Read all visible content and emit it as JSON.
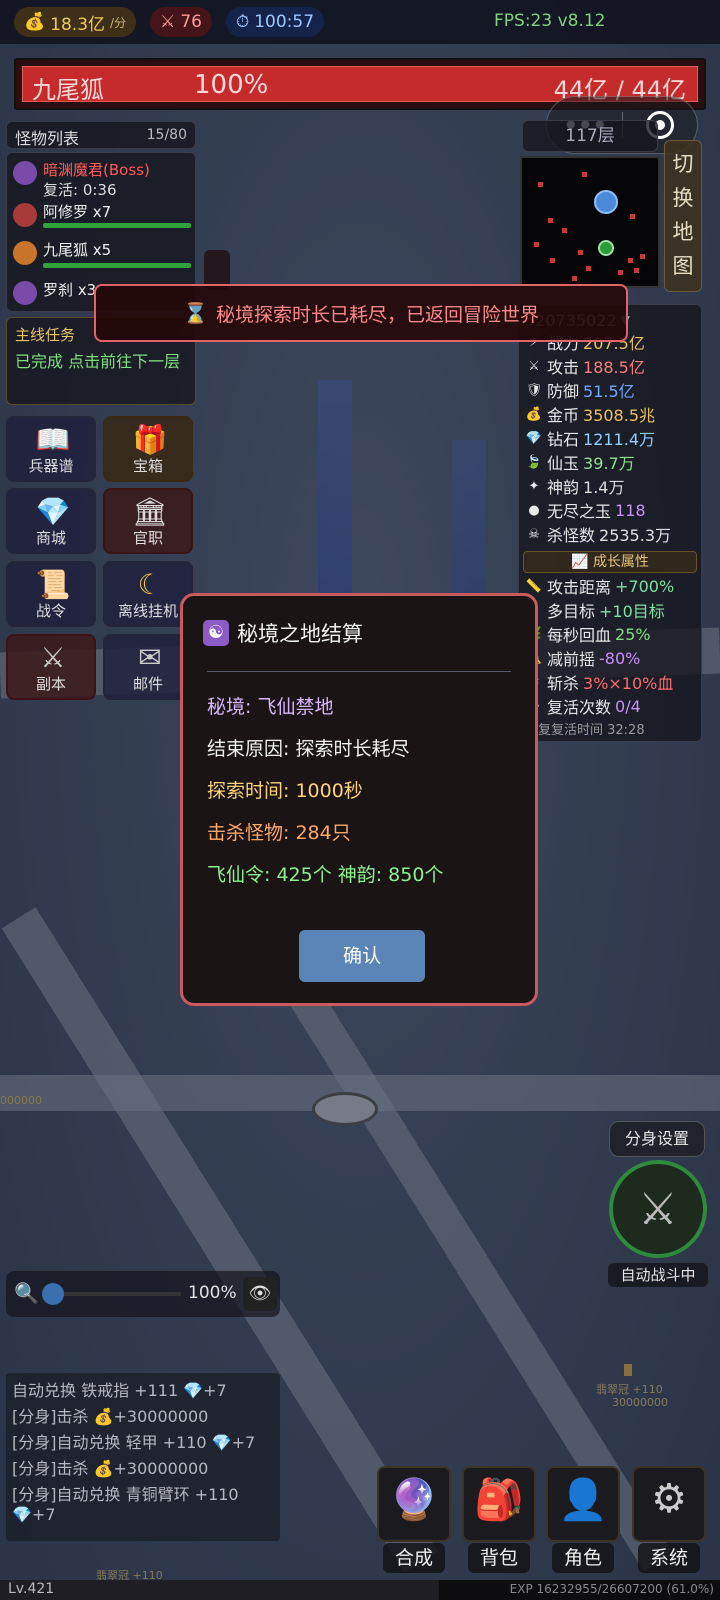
{
  "topbar": {
    "gold_rate": "18.3亿",
    "gold_unit": "/分",
    "power_value": "76",
    "timer": "100:57",
    "fps": "FPS:23 v8.12"
  },
  "boss_bar": {
    "name": "九尾狐",
    "percent_text": "100%",
    "hp_text": "44亿 / 44亿",
    "hp_fraction": 1.0
  },
  "monster_list": {
    "title": "怪物列表",
    "count": "15/80",
    "items": [
      {
        "label": "暗渊魔君(Boss)",
        "sub": "复活: 0:36",
        "icon": "demon-icon"
      },
      {
        "label": "阿修罗 x7",
        "icon": "oni-icon"
      },
      {
        "label": "九尾狐 x5",
        "icon": "fox-icon"
      },
      {
        "label": "罗刹 x3",
        "icon": "demon-icon"
      }
    ]
  },
  "quest": {
    "title": "主线任务",
    "desc": "已完成 点击前往下一层"
  },
  "menu": [
    {
      "label": "兵器谱",
      "icon": "book-icon"
    },
    {
      "label": "宝箱",
      "icon": "gift-icon"
    },
    {
      "label": "商城",
      "icon": "diamond-icon"
    },
    {
      "label": "官职",
      "icon": "temple-icon"
    },
    {
      "label": "战令",
      "icon": "scroll-icon"
    },
    {
      "label": "离线挂机",
      "icon": "moon-icon"
    },
    {
      "label": "副本",
      "icon": "crossed-swords-icon"
    },
    {
      "label": "邮件",
      "icon": "mail-icon"
    }
  ],
  "right": {
    "floor": "117层",
    "switch_map": [
      "切",
      "换",
      "地",
      "图"
    ],
    "player_id": "520735022",
    "stats": [
      {
        "label": "战力",
        "value": "207.5亿",
        "color": "#f0c060",
        "icon": "power-icon"
      },
      {
        "label": "攻击",
        "value": "188.5亿",
        "color": "#ff7a7a",
        "icon": "sword-icon"
      },
      {
        "label": "防御",
        "value": "51.5亿",
        "color": "#6fa8ff",
        "icon": "shield-icon"
      },
      {
        "label": "金币",
        "value": "3508.5兆",
        "color": "#f0c060",
        "icon": "coin-bag-icon"
      },
      {
        "label": "钻石",
        "value": "1211.4万",
        "color": "#8fd0ff",
        "icon": "gem-icon"
      },
      {
        "label": "仙玉",
        "value": "39.7万",
        "color": "#8fe08f",
        "icon": "jade-icon"
      },
      {
        "label": "神韵",
        "value": "1.4万",
        "color": "#dddddd",
        "icon": "spirit-icon"
      },
      {
        "label": "无尽之玉",
        "value": "118",
        "color": "#c98fff",
        "icon": "orb-icon"
      },
      {
        "label": "杀怪数",
        "value": "2535.3万",
        "color": "#e0e0e0",
        "icon": "skull-icon"
      }
    ],
    "growth_title": "成长属性",
    "growth": [
      {
        "label": "攻击距离",
        "value": "+700%",
        "color": "#7fe0a0",
        "icon": "ruler-icon"
      },
      {
        "label": "多目标",
        "value": "+10目标",
        "color": "#7fe0a0",
        "icon": "multi-icon"
      },
      {
        "label": "每秒回血",
        "value": "25%",
        "color": "#7fe07f",
        "icon": "leaf-icon"
      },
      {
        "label": "减前摇",
        "value": "-80%",
        "color": "#c98fff",
        "icon": "bell-icon"
      },
      {
        "label": "斩杀",
        "value": "3%×10%血",
        "color": "#ff6a6a",
        "icon": "slash-icon"
      },
      {
        "label": "复活次数",
        "value": "0/4",
        "color": "#c98fff",
        "icon": "revive-icon"
      }
    ],
    "revive_time": "恢复复活时间 32:28"
  },
  "toast": {
    "icon": "hourglass-icon",
    "text": "秘境探索时长已耗尽，已返回冒险世界"
  },
  "dialog": {
    "title": "秘境之地结算",
    "icon": "yin-yang-icon",
    "realm": "秘境: 飞仙禁地",
    "reason": "结束原因: 探索时长耗尽",
    "time": "探索时间: 1000秒",
    "kills": "击杀怪物: 284只",
    "rewards": "飞仙令: 425个  神韵: 850个",
    "confirm": "确认",
    "colors": {
      "realm": "#d8b4ff",
      "reason": "#f0f0f0",
      "time": "#ffd27a",
      "kills": "#ffa868",
      "rewards": "#8ff08f"
    }
  },
  "clone_settings": "分身设置",
  "auto_battle": "自动战斗中",
  "zoom": {
    "percent": "100%"
  },
  "log": [
    "自动兑换 铁戒指 +111 💎+7",
    "[分身]击杀 💰+30000000",
    "[分身]自动兑换 轻甲 +110 💎+7",
    "[分身]击杀 💰+30000000",
    "[分身]自动兑换 青铜臂环 +110",
    "💎+7"
  ],
  "bottom": [
    {
      "label": "合成",
      "icon": "crystal-ball-icon"
    },
    {
      "label": "背包",
      "icon": "backpack-icon"
    },
    {
      "label": "角色",
      "icon": "person-icon"
    },
    {
      "label": "系统",
      "icon": "gear-icon"
    }
  ],
  "ground": {
    "drop_name": "翡翠冠 +110",
    "drop_gold": "30000000",
    "left_gold": "000000",
    "bottom_drop": "翡翠冠 +110"
  },
  "exp": {
    "level": "Lv.421",
    "text": "EXP 16232955/26607200 (61.0%)",
    "fraction": 0.61
  }
}
